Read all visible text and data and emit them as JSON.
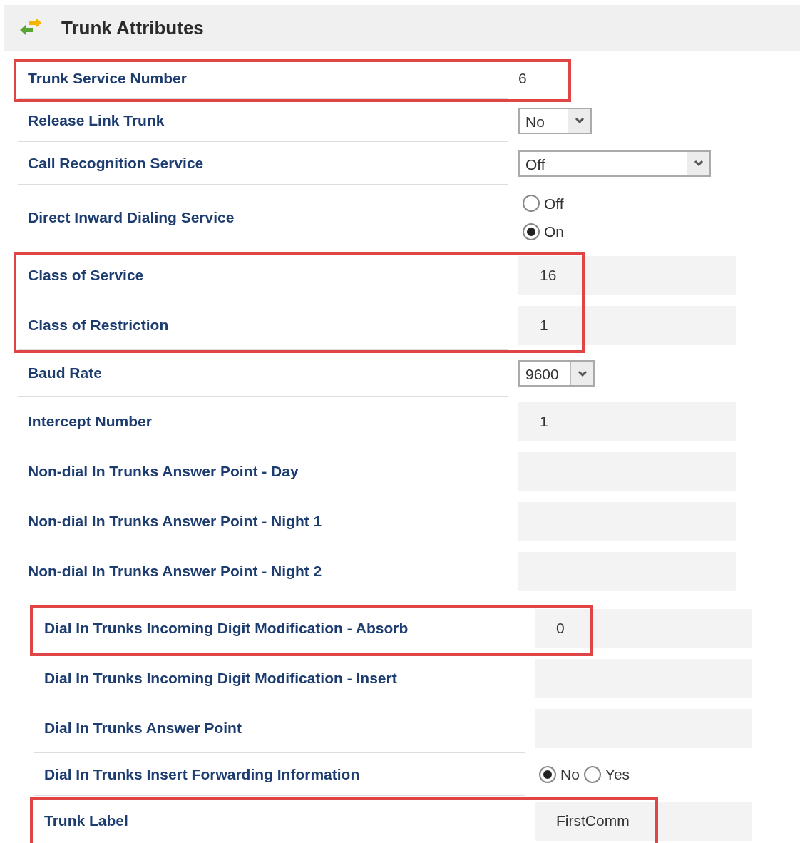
{
  "header": {
    "title": "Trunk Attributes"
  },
  "sections": [
    {
      "rows": [
        {
          "label": "Trunk Service Number",
          "kind": "text",
          "value": "6",
          "highlighted": true
        },
        {
          "label": "Release Link Trunk",
          "kind": "select",
          "value": "No",
          "highlighted": false
        },
        {
          "label": "Call Recognition Service",
          "kind": "select_wide",
          "value": "Off",
          "highlighted": false
        },
        {
          "label": "Direct Inward Dialing Service",
          "kind": "radio_stack",
          "options": [
            {
              "label": "Off",
              "selected": false
            },
            {
              "label": "On",
              "selected": true
            }
          ],
          "highlighted": false
        },
        {
          "label": "Class of Service",
          "kind": "field",
          "value": "16",
          "highlighted": true
        },
        {
          "label": "Class of Restriction",
          "kind": "field",
          "value": "1",
          "highlighted": true
        },
        {
          "label": "Baud Rate",
          "kind": "select",
          "value": "9600",
          "highlighted": false
        },
        {
          "label": "Intercept Number",
          "kind": "field",
          "value": "1",
          "highlighted": false
        },
        {
          "label": "Non-dial In Trunks Answer Point - Day",
          "kind": "field",
          "highlighted": false
        },
        {
          "label": "Non-dial In Trunks Answer Point - Night 1",
          "kind": "field",
          "highlighted": false
        },
        {
          "label": "Non-dial In Trunks Answer Point - Night 2",
          "kind": "field",
          "highlighted": false
        }
      ]
    },
    {
      "rows": [
        {
          "label": "Dial In Trunks Incoming Digit Modification - Absorb",
          "kind": "field",
          "value": "0",
          "highlighted": true
        },
        {
          "label": "Dial In Trunks Incoming Digit Modification - Insert",
          "kind": "field",
          "highlighted": false
        },
        {
          "label": "Dial In Trunks Answer Point",
          "kind": "field",
          "highlighted": false
        },
        {
          "label": "Dial In Trunks Insert Forwarding Information",
          "kind": "radio_inline",
          "options": [
            {
              "label": "No",
              "selected": true
            },
            {
              "label": "Yes",
              "selected": false
            }
          ],
          "highlighted": false
        },
        {
          "label": "Trunk Label",
          "kind": "field",
          "value": "FirstComm",
          "highlighted": true
        }
      ]
    }
  ]
}
